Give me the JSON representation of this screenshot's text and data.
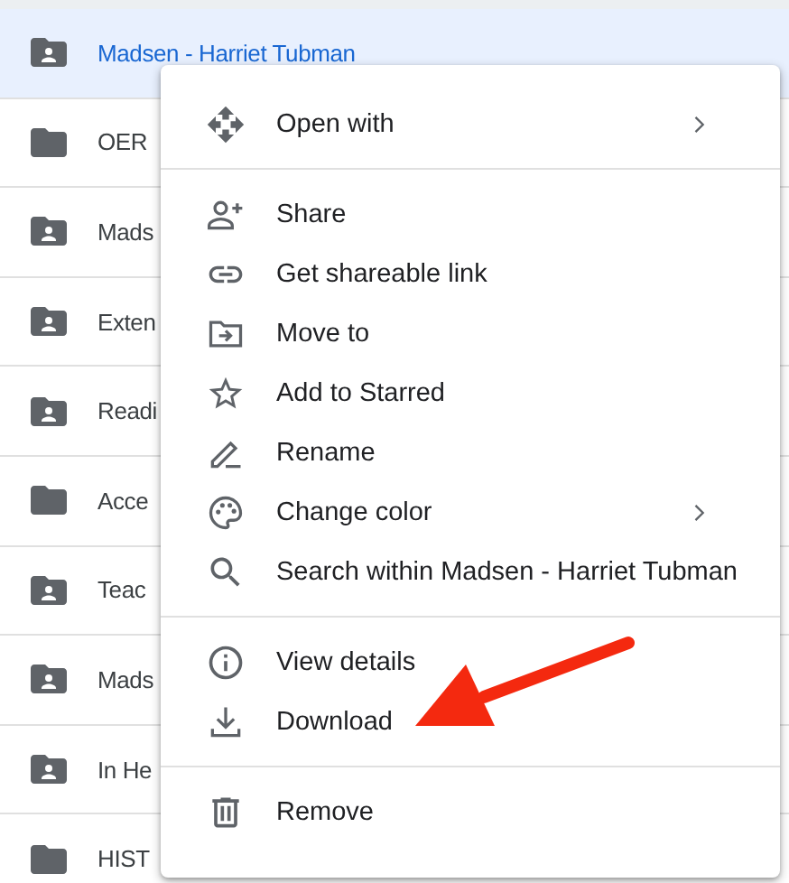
{
  "file_list": {
    "rows": [
      {
        "name": "Madsen - Harriet Tubman",
        "kind": "shared",
        "selected": true
      },
      {
        "name": "OER",
        "kind": "plain",
        "selected": false
      },
      {
        "name": "Mads",
        "kind": "shared",
        "selected": false
      },
      {
        "name": "Exten",
        "kind": "shared",
        "selected": false
      },
      {
        "name": "Readi",
        "kind": "shared",
        "selected": false
      },
      {
        "name": "Acce",
        "kind": "plain",
        "selected": false
      },
      {
        "name": "Teac",
        "kind": "shared",
        "selected": false
      },
      {
        "name": "Mads",
        "kind": "shared",
        "selected": false
      },
      {
        "name": "In He",
        "kind": "shared",
        "selected": false
      },
      {
        "name": "HIST",
        "kind": "plain",
        "selected": false
      }
    ]
  },
  "context_menu": {
    "sections": [
      {
        "items": [
          {
            "label": "Open with",
            "kind": "open_with",
            "submenu": true
          }
        ]
      },
      {
        "items": [
          {
            "label": "Share",
            "kind": "share",
            "submenu": false
          },
          {
            "label": "Get shareable link",
            "kind": "link",
            "submenu": false
          },
          {
            "label": "Move to",
            "kind": "move",
            "submenu": false
          },
          {
            "label": "Add to Starred",
            "kind": "star",
            "submenu": false
          },
          {
            "label": "Rename",
            "kind": "rename",
            "submenu": false
          },
          {
            "label": "Change color",
            "kind": "color",
            "submenu": true
          },
          {
            "label": "Search within Madsen - Harriet Tubman",
            "kind": "search",
            "submenu": false
          }
        ]
      },
      {
        "items": [
          {
            "label": "View details",
            "kind": "details",
            "submenu": false
          },
          {
            "label": "Download",
            "kind": "download",
            "submenu": false
          }
        ]
      },
      {
        "items": [
          {
            "label": "Remove",
            "kind": "remove",
            "submenu": false
          }
        ]
      }
    ]
  }
}
